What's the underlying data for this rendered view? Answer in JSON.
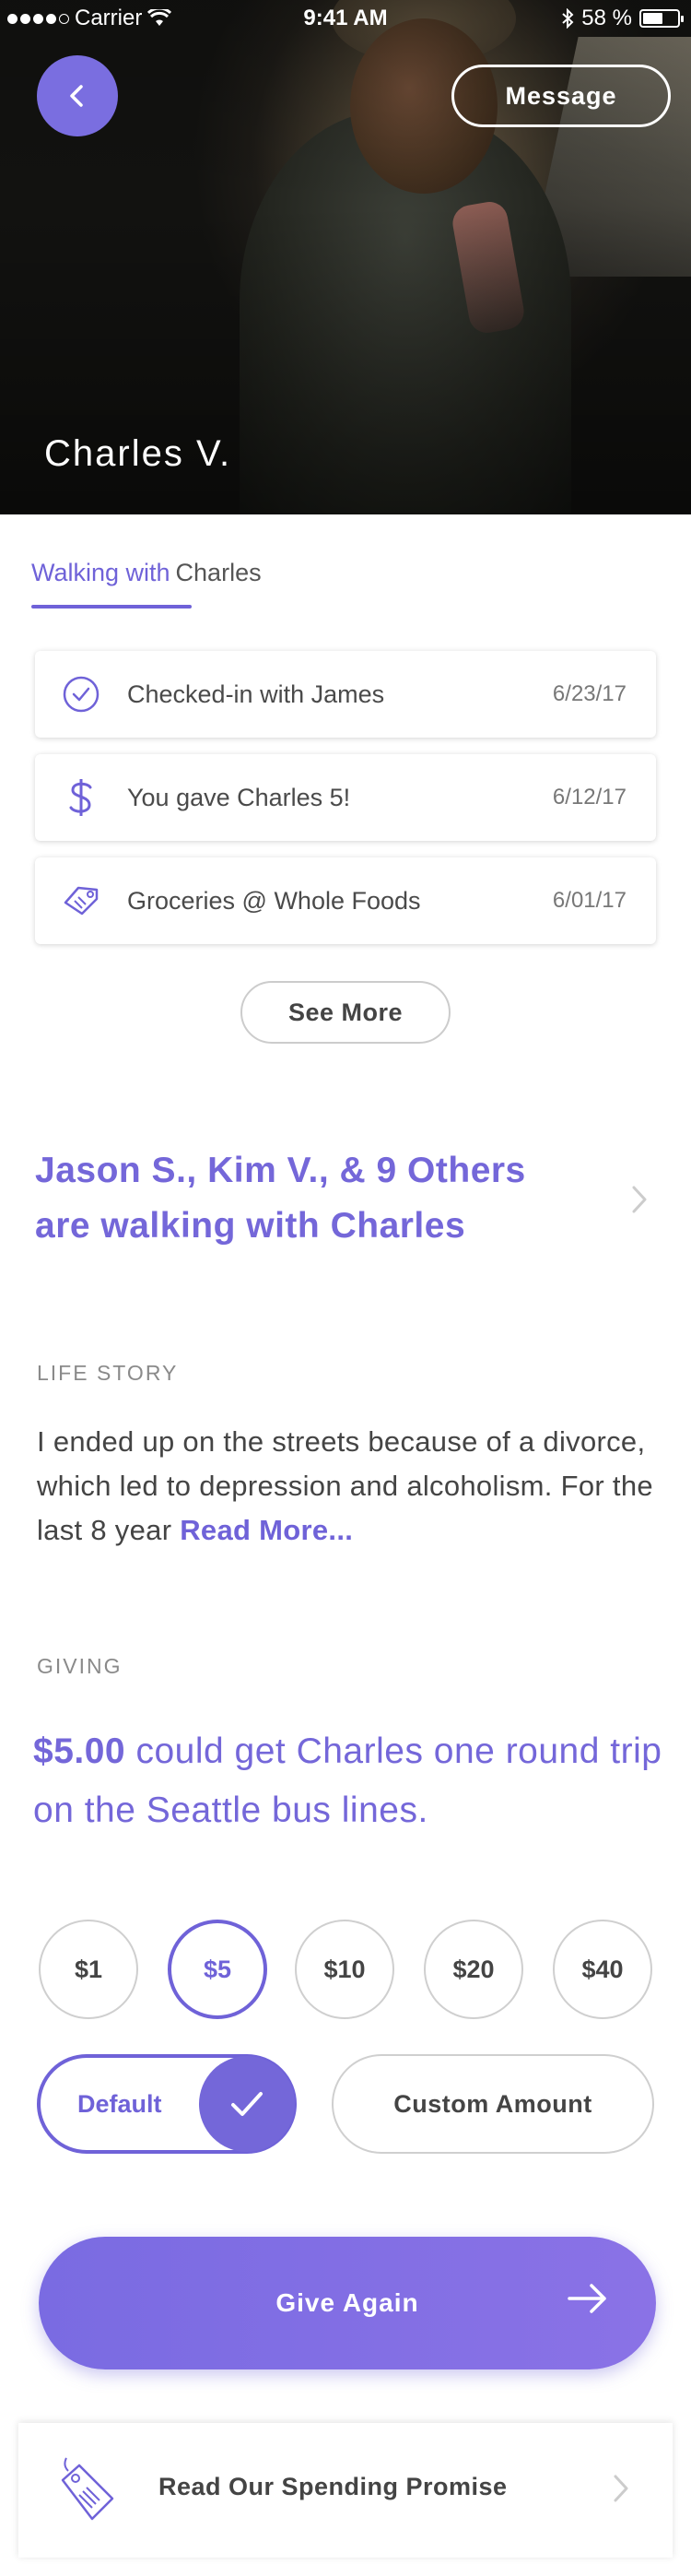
{
  "status_bar": {
    "carrier": "Carrier",
    "time": "9:41 AM",
    "battery_percent": "58 %",
    "battery_level": 0.58
  },
  "header": {
    "message_label": "Message",
    "name": "Charles V."
  },
  "tabs": {
    "active": "Walking with",
    "name": "Charles"
  },
  "activity": [
    {
      "icon": "check-circle-icon",
      "text": "Checked-in with James",
      "date": "6/23/17"
    },
    {
      "icon": "dollar-icon",
      "text": "You gave Charles 5!",
      "date": "6/12/17"
    },
    {
      "icon": "tag-icon",
      "text": "Groceries @ Whole Foods",
      "date": "6/01/17"
    }
  ],
  "see_more_label": "See More",
  "walkers": {
    "line1": "Jason S., Kim V., & 9 Others",
    "line2": "are walking with Charles"
  },
  "life_story": {
    "label": "LIFE STORY",
    "text": "I ended up on the streets because of a divorce, which led to depression and alcoholism. For the last 8 year ",
    "read_more": "Read More..."
  },
  "giving": {
    "label": "GIVING",
    "amount": "$5.00",
    "description": " could get Charles one round trip on the Seattle bus lines."
  },
  "amounts": [
    "$1",
    "$5",
    "$10",
    "$20",
    "$40"
  ],
  "selected_amount": "$5",
  "default_label": "Default",
  "custom_amount_label": "Custom Amount",
  "give_again_label": "Give Again",
  "spending_promise_label": "Read Our Spending Promise",
  "colors": {
    "accent": "#6f62d8",
    "button_gradient": "#7a6be2"
  }
}
